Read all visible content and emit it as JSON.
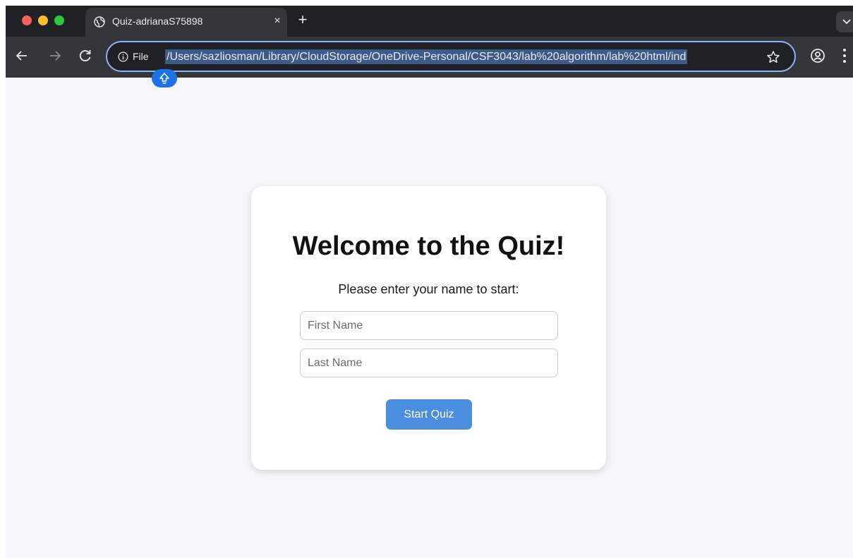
{
  "browser": {
    "tab": {
      "title": "Quiz-adrianaS75898",
      "close_glyph": "×",
      "icon": "globe-icon"
    },
    "new_tab_glyph": "+",
    "address_bar": {
      "scheme_label": "File",
      "url": "/Users/sazliosman/Library/CloudStorage/OneDrive-Personal/CSF3043/lab%20algorithm/lab%20html/ind"
    },
    "icons": [
      "back-arrow-icon",
      "forward-arrow-icon",
      "reload-icon",
      "info-icon",
      "star-icon",
      "profile-icon",
      "menu-icon",
      "shift-key-icon",
      "chevron-down-icon"
    ]
  },
  "colors": {
    "chrome_bg": "#202124",
    "toolbar_bg": "#35363a",
    "omnibox_border": "#8ab4f8",
    "url_highlight": "#3c5a8a",
    "page_bg": "#f4f6f9",
    "button_accent": "#4a8fdf"
  },
  "quiz": {
    "title": "Welcome to the Quiz!",
    "subtitle": "Please enter your name to start:",
    "first_name": {
      "value": "",
      "placeholder": "First Name"
    },
    "last_name": {
      "value": "",
      "placeholder": "Last Name"
    },
    "start_label": "Start Quiz"
  }
}
